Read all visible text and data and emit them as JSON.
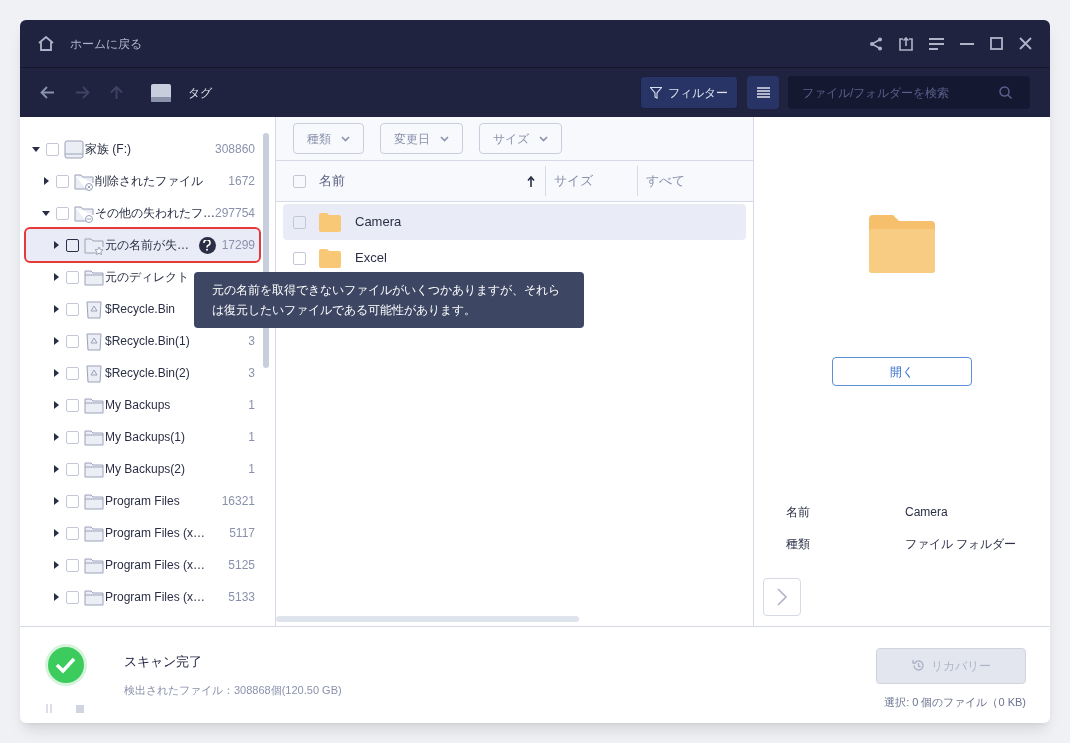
{
  "title_bar": {
    "home_label": "ホームに戻る"
  },
  "toolbar": {
    "location": "タグ",
    "filter_button": "フィルター",
    "search": {
      "placeholder": "ファイル/フォルダーを検索"
    }
  },
  "tree": [
    {
      "label": "家族 (F:)",
      "count": "308860",
      "kind": "drive",
      "expanded": true,
      "selected": false,
      "checked": false,
      "children": [
        {
          "label": "削除されたファイル",
          "count": "1672",
          "kind": "deleted",
          "expanded": false,
          "selected": false,
          "checked": false
        },
        {
          "label": "その他の失われたフ…",
          "count": "297754",
          "kind": "lost",
          "expanded": true,
          "selected": false,
          "checked": false,
          "children": [
            {
              "label": "元の名前が失…",
              "count": "17299",
              "kind": "star",
              "expanded": false,
              "selected": true,
              "checked": false,
              "help": true
            },
            {
              "label": "元のディレクト",
              "kind": "folder",
              "expanded": false,
              "selected": false,
              "checked": false
            },
            {
              "label": "$Recycle.Bin",
              "kind": "recycle",
              "expanded": false,
              "selected": false,
              "checked": false
            },
            {
              "label": "$Recycle.Bin(1)",
              "count": "3",
              "kind": "recycle",
              "expanded": false,
              "selected": false,
              "checked": false
            },
            {
              "label": "$Recycle.Bin(2)",
              "count": "3",
              "kind": "recycle",
              "expanded": false,
              "selected": false,
              "checked": false
            },
            {
              "label": "My Backups",
              "count": "1",
              "kind": "folder",
              "expanded": false,
              "selected": false,
              "checked": false
            },
            {
              "label": "My Backups(1)",
              "count": "1",
              "kind": "folder",
              "expanded": false,
              "selected": false,
              "checked": false
            },
            {
              "label": "My Backups(2)",
              "count": "1",
              "kind": "folder",
              "expanded": false,
              "selected": false,
              "checked": false
            },
            {
              "label": "Program Files",
              "count": "16321",
              "kind": "folder",
              "expanded": false,
              "selected": false,
              "checked": false
            },
            {
              "label": "Program Files (x…",
              "count": "5117",
              "kind": "folder",
              "expanded": false,
              "selected": false,
              "checked": false
            },
            {
              "label": "Program Files (x…",
              "count": "5125",
              "kind": "folder",
              "expanded": false,
              "selected": false,
              "checked": false
            },
            {
              "label": "Program Files (x…",
              "count": "5133",
              "kind": "folder",
              "expanded": false,
              "selected": false,
              "checked": false
            }
          ]
        }
      ]
    }
  ],
  "tooltip": "元の名前を取得できないファイルがいくつかありますが、それらは復元したいファイルである可能性があります。",
  "filters": [
    "種類",
    "変更日",
    "サイズ"
  ],
  "select_all": {
    "checked": false
  },
  "columns": [
    {
      "label": "名前",
      "sorted": true
    },
    {
      "label": "サイズ",
      "sorted": false
    },
    {
      "label": "すべて",
      "sorted": false
    }
  ],
  "files": [
    {
      "name": "Camera",
      "selected": true,
      "checked": false
    },
    {
      "name": "Excel",
      "selected": false,
      "checked": false
    }
  ],
  "preview": {
    "open_button": "開く",
    "details": [
      {
        "label": "名前",
        "value": "Camera"
      },
      {
        "label": "種類",
        "value": "ファイル フォルダー"
      }
    ]
  },
  "status": {
    "title": "スキャン完了",
    "found": "検出されたファイル：308868個(120.50 GB)",
    "recover_button": {
      "label": "リカバリー",
      "disabled": true
    },
    "selection": "選択: 0 個のファイル（0 KB)"
  }
}
